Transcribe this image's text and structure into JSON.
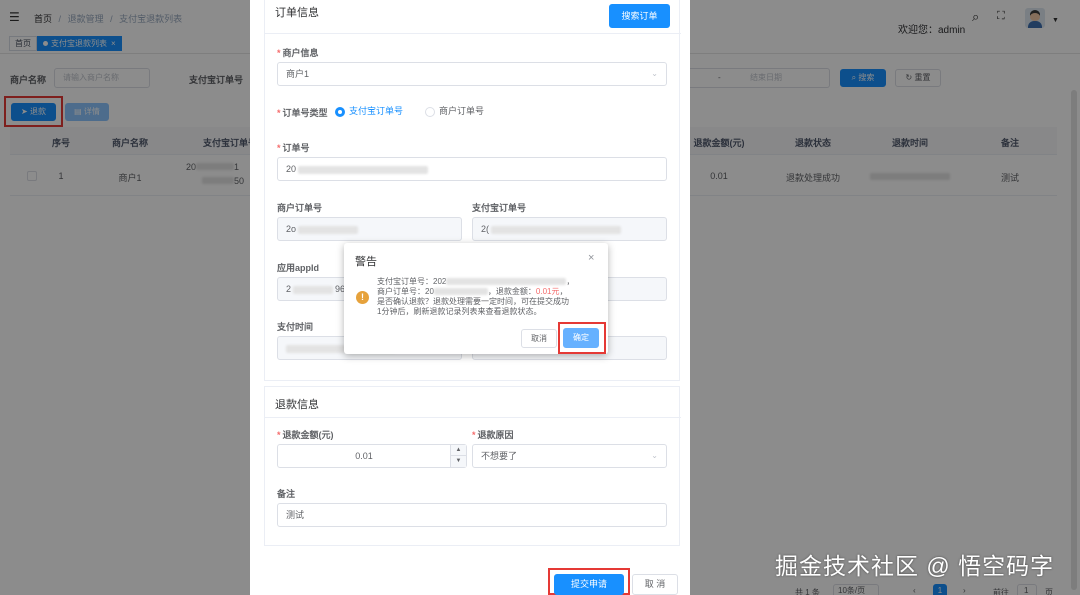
{
  "header": {
    "breadcrumb": [
      "首页",
      "退款管理",
      "支付宝退款列表"
    ],
    "breadcrumb_sep": "/",
    "welcome": "欢迎您：admin"
  },
  "tags": [
    "首页",
    "支付宝退款列表"
  ],
  "filter": {
    "merchant_label": "商户名称",
    "merchant_placeholder": "请输入商户名称",
    "alipay_label": "支付宝订单号",
    "date_sep": "-",
    "end_date_placeholder": "结束日期",
    "search": "搜索",
    "reset": "重置"
  },
  "toolbar": {
    "refund": "退款",
    "detail": "详情"
  },
  "table": {
    "headers_left": [
      "序号",
      "商户名称",
      "支付宝订单号"
    ],
    "headers_right": [
      "退款金额(元)",
      "退款状态",
      "退款时间",
      "备注"
    ],
    "row": {
      "index": "1",
      "merchant": "商户1",
      "order_a": "20",
      "order_b": "1",
      "order_c": "50",
      "amount": "0.01",
      "status": "退款处理成功",
      "note": "测试"
    }
  },
  "pagination": {
    "total": "共 1 条",
    "size": "10条/页",
    "page": "1",
    "goto": "前往",
    "goto_val": "1",
    "unit": "页"
  },
  "form": {
    "order_section": "订单信息",
    "search_order": "搜索订单",
    "merchant_info_label": "商户信息",
    "merchant_value": "商户1",
    "order_type_label": "订单号类型",
    "order_type_options": [
      "支付宝订单号",
      "商户订单号"
    ],
    "order_no_label": "订单号",
    "order_no_prefix": "20",
    "merchant_order_label": "商户订单号",
    "merchant_order_prefix": "2o",
    "alipay_order_label": "支付宝订单号",
    "alipay_order_prefix": "2(",
    "appid_label": "应用appId",
    "appid_prefix": "2",
    "appid_suffix": "96",
    "pay_time_label": "支付时间",
    "refund_section": "退款信息",
    "refund_amount_label": "退款金额(元)",
    "refund_amount": "0.01",
    "refund_reason_label": "退款原因",
    "refund_reason": "不想要了",
    "note_label": "备注",
    "note_value": "测试",
    "submit": "提交申请",
    "cancel": "取 消"
  },
  "dialog": {
    "title": "警告",
    "line1_prefix": "支付宝订单号：202",
    "line1_suffix": "，",
    "line2_prefix": "商户订单号：20",
    "line2_mid": "，退款金额：",
    "line2_amount": "0.01元",
    "line2_end": "，",
    "line3": "是否确认退款？退款处理需要一定时间，可在提交成功",
    "line4": "1分钟后，刷新退款记录列表来查看退款状态。",
    "cancel": "取消",
    "confirm": "确定"
  },
  "watermark": "掘金技术社区 @ 悟空码字",
  "colors": {
    "primary": "#1890ff",
    "danger": "#f56c6c",
    "warning": "#e6a23c",
    "highlight": "#e53935"
  }
}
